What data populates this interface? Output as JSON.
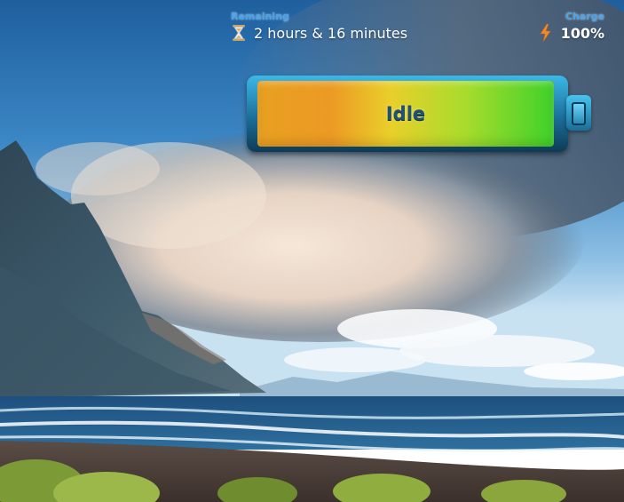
{
  "remaining": {
    "label": "Remaining",
    "value": "2 hours & 16 minutes",
    "icon": "hourglass-icon"
  },
  "charge": {
    "label": "Charge",
    "value": "100%",
    "icon": "lightning-icon",
    "level_percent": 100
  },
  "battery": {
    "status": "Idle"
  },
  "colors": {
    "label_accent": "#4aa3e8",
    "fill_start": "#e8a020",
    "fill_end": "#3fd12a",
    "shell": "#1b6f99",
    "lightning": "#f28a2a"
  }
}
